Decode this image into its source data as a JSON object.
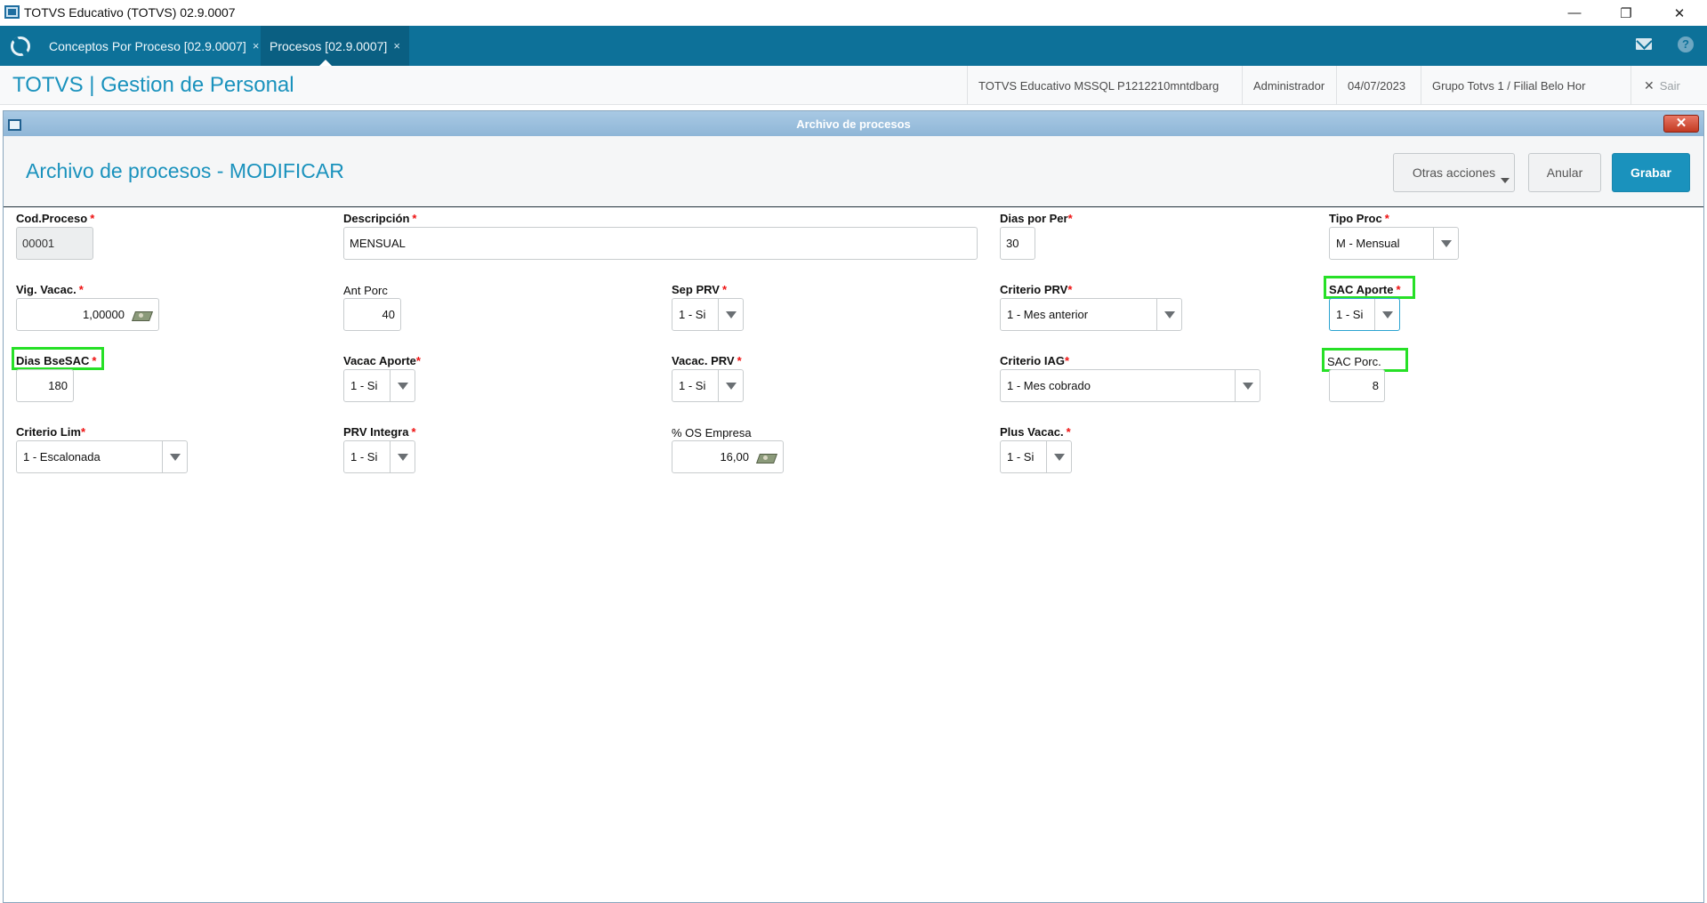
{
  "window": {
    "title": "TOTVS Educativo (TOTVS) 02.9.0007",
    "minimize": "—",
    "restore": "❐",
    "close": "✕"
  },
  "tabs": [
    {
      "label": "Conceptos Por Proceso [02.9.0007]",
      "close": "×"
    },
    {
      "label": "Procesos [02.9.0007]",
      "close": "×"
    }
  ],
  "header": {
    "app_title": "TOTVS | Gestion de Personal",
    "environment": "TOTVS Educativo MSSQL P1212210mntdbarg",
    "user": "Administrador",
    "date": "04/07/2023",
    "branch": "Grupo Totvs 1 / Filial Belo Hor",
    "exit_label": "Sair",
    "exit_icon": "✕"
  },
  "dialog": {
    "title": "Archivo de procesos",
    "close": "✕",
    "form_title": "Archivo de procesos - MODIFICAR",
    "buttons": {
      "other_actions": "Otras acciones",
      "cancel": "Anular",
      "save": "Grabar"
    }
  },
  "fields": {
    "cod_proceso": {
      "label": "Cod.Proceso",
      "req": "*",
      "value": "00001"
    },
    "descripcion": {
      "label": "Descripción",
      "req": "*",
      "value": "MENSUAL"
    },
    "dias_por_per": {
      "label": "Dias por Per",
      "req": "*",
      "value": "30"
    },
    "tipo_proc": {
      "label": "Tipo Proc",
      "req": "*",
      "value": "M - Mensual"
    },
    "vig_vacac": {
      "label": "Vig. Vacac.",
      "req": "*",
      "value": "1,00000"
    },
    "ant_porc": {
      "label": "Ant Porc",
      "value": "40"
    },
    "sep_prv": {
      "label": "Sep PRV",
      "req": "*",
      "value": "1 - Si"
    },
    "criterio_prv": {
      "label": "Criterio PRV",
      "req": "*",
      "value": "1 - Mes anterior"
    },
    "sac_aporte": {
      "label": "SAC Aporte",
      "req": "*",
      "value": "1 - Si"
    },
    "dias_bsesac": {
      "label": "Dias BseSAC",
      "req": "*",
      "value": "180"
    },
    "vacac_aporte": {
      "label": "Vacac Aporte",
      "req": "*",
      "value": "1 - Si"
    },
    "vacac_prv": {
      "label": "Vacac. PRV",
      "req": "*",
      "value": "1 - Si"
    },
    "criterio_iag": {
      "label": "Criterio IAG",
      "req": "*",
      "value": "1 - Mes cobrado"
    },
    "sac_porc": {
      "label": "SAC Porc.",
      "value": "8"
    },
    "criterio_lim": {
      "label": "Criterio Lim",
      "req": "*",
      "value": "1 - Escalonada"
    },
    "prv_integra": {
      "label": "PRV Integra",
      "req": "*",
      "value": "1 - Si"
    },
    "os_empresa": {
      "label": "% OS Empresa",
      "value": "16,00"
    },
    "plus_vacac": {
      "label": "Plus Vacac.",
      "req": "*",
      "value": "1 - Si"
    }
  },
  "colors": {
    "brand": "#0d7199",
    "accent": "#1a92bd",
    "highlight": "#27e027",
    "required": "#e11111"
  }
}
